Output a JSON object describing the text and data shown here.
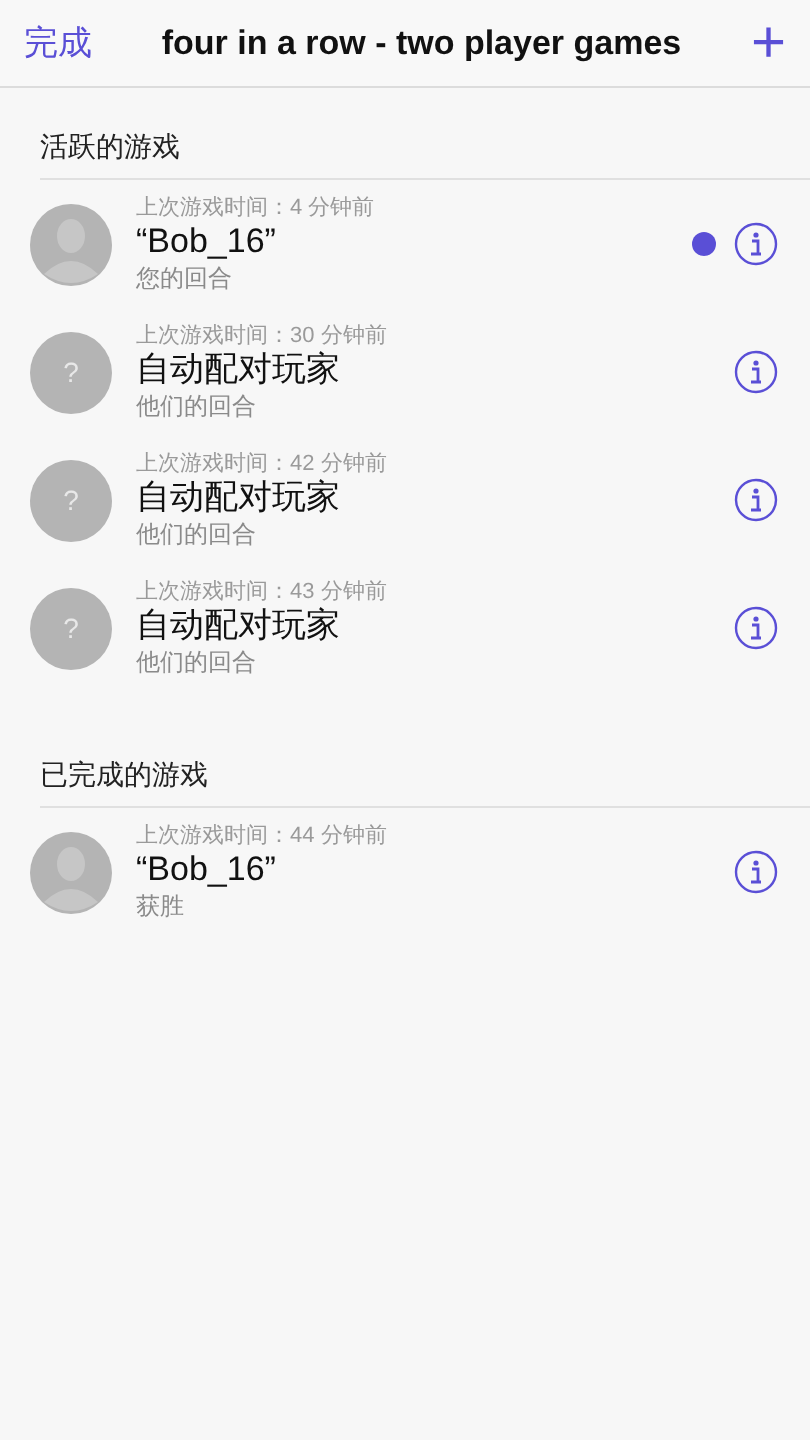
{
  "nav_bar": {
    "done_button": "完成",
    "title": "four in a row - two player games",
    "add_button": "+"
  },
  "sections": [
    {
      "header": "活跃的游戏",
      "games": [
        {
          "kind": "person",
          "last_played": "上次游戏时间：4 分钟前",
          "opponent": "“Bob_16”",
          "status": "您的回合",
          "unread": true
        },
        {
          "kind": "unknown",
          "avatar_label": "?",
          "last_played": "上次游戏时间：30 分钟前",
          "opponent": "自动配对玩家",
          "status": "他们的回合",
          "unread": false
        },
        {
          "kind": "unknown",
          "avatar_label": "?",
          "last_played": "上次游戏时间：42 分钟前",
          "opponent": "自动配对玩家",
          "status": "他们的回合",
          "unread": false
        },
        {
          "kind": "unknown",
          "avatar_label": "?",
          "last_played": "上次游戏时间：43 分钟前",
          "opponent": "自动配对玩家",
          "status": "他们的回合",
          "unread": false
        }
      ]
    },
    {
      "header": "已完成的游戏",
      "games": [
        {
          "kind": "person",
          "last_played": "上次游戏时间：44 分钟前",
          "opponent": "“Bob_16”",
          "status": "获胜",
          "unread": false
        }
      ]
    }
  ]
}
